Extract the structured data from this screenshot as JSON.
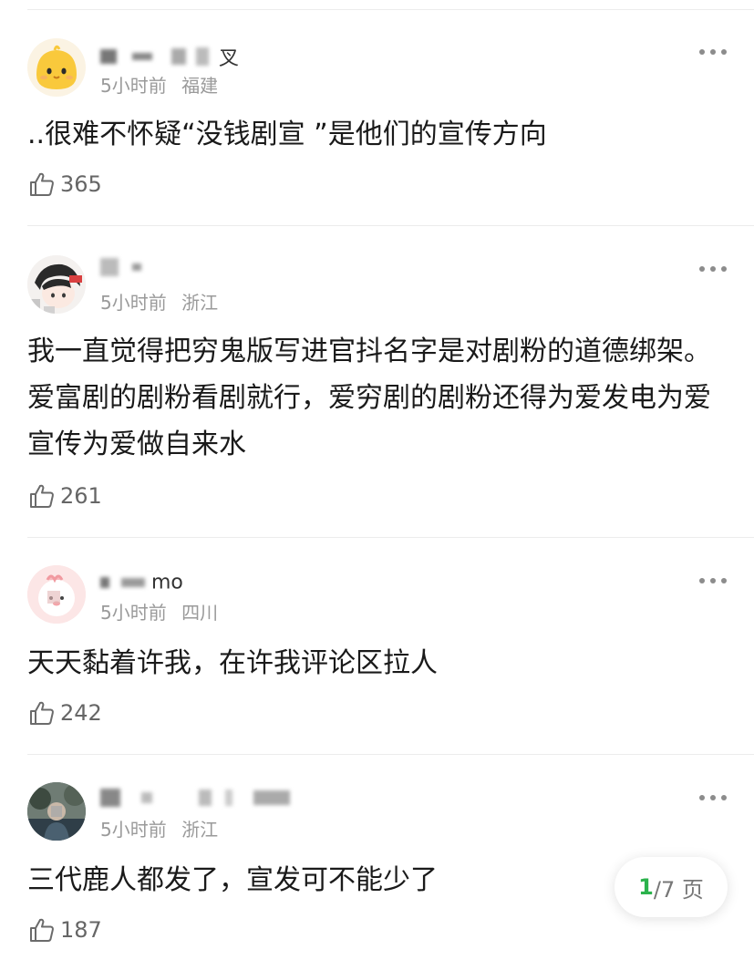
{
  "theme": {
    "accent_green": "#2bb24c",
    "meta_gray": "#9a9a9a",
    "divider": "#ececec"
  },
  "comments": [
    {
      "username_visible": "叉",
      "time": "5小时前",
      "location": "福建",
      "content": "..很难不怀疑“没钱剧宣 ”是他们的宣传方向",
      "likes": "365",
      "avatar_icon": "yellow-chick-emoji-icon"
    },
    {
      "username_visible": "",
      "time": "5小时前",
      "location": "浙江",
      "content": "我一直觉得把穷鬼版写进官抖名字是对剧粉的道德绑架。爱富剧的剧粉看剧就行，爱穷剧的剧粉还得为爱发电为爱宣传为爱做自来水",
      "likes": "261",
      "avatar_icon": "anime-character-avatar-icon"
    },
    {
      "username_visible": "mo",
      "time": "5小时前",
      "location": "四川",
      "content": "天天黏着许我，在许我评论区拉人",
      "likes": "242",
      "avatar_icon": "pink-cartoon-avatar-icon"
    },
    {
      "username_visible": "",
      "time": "5小时前",
      "location": "浙江",
      "content": "三代鹿人都发了，宣发可不能少了",
      "likes": "187",
      "avatar_icon": "photo-avatar-icon"
    }
  ],
  "pager": {
    "current": "1",
    "rest": "/7 页"
  }
}
